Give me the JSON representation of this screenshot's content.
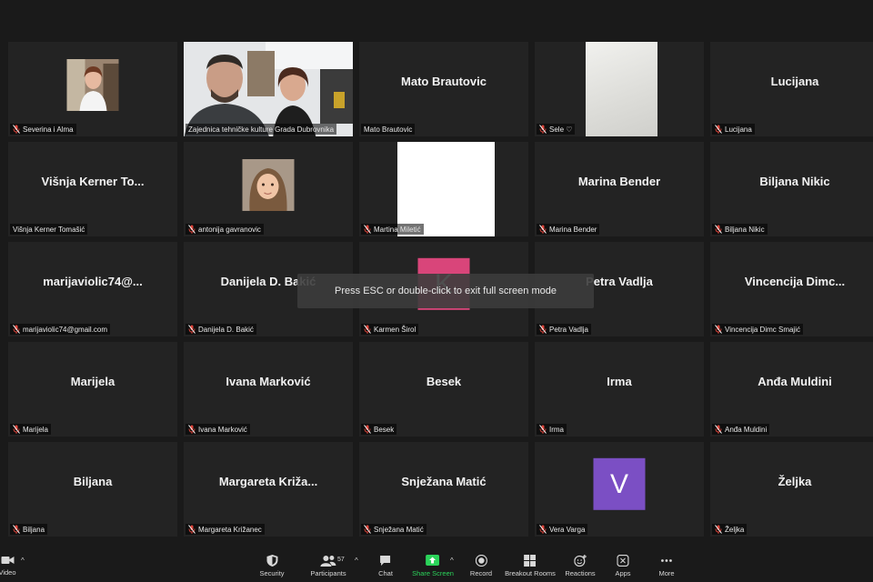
{
  "participants": [
    {
      "name": "Severina i Alma",
      "display": "",
      "muted": true,
      "kind": "photo-woman"
    },
    {
      "name": "Zajednica tehničke kulture Grada Dubrovnika",
      "display": "",
      "muted": false,
      "kind": "video-people",
      "speaking": true
    },
    {
      "name": "Mato Brautovic",
      "display": "Mato Brautovic",
      "muted": false,
      "kind": "name"
    },
    {
      "name": "Sele ♡",
      "display": "",
      "muted": true,
      "kind": "video-wall"
    },
    {
      "name": "Lucijana",
      "display": "Lucijana",
      "muted": true,
      "kind": "name"
    },
    {
      "name": "Višnja Kerner Tomašić",
      "display": "Višnja Kerner To...",
      "muted": false,
      "kind": "name"
    },
    {
      "name": "antonija gavranovic",
      "display": "",
      "muted": true,
      "kind": "photo-child"
    },
    {
      "name": "Martina Miletić",
      "display": "",
      "muted": true,
      "kind": "white"
    },
    {
      "name": "Marina Bender",
      "display": "Marina Bender",
      "muted": true,
      "kind": "name"
    },
    {
      "name": "Biljana Nikic",
      "display": "Biljana Nikic",
      "muted": true,
      "kind": "name"
    },
    {
      "name": "marijaviolic74@gmail.com",
      "display": "marijaviolic74@...",
      "muted": true,
      "kind": "name"
    },
    {
      "name": "Danijela D. Bakić",
      "display": "Danijela D. Bakić",
      "muted": true,
      "kind": "name"
    },
    {
      "name": "Karmen Širol",
      "display": "K",
      "muted": true,
      "kind": "letter",
      "color": "#d9457a"
    },
    {
      "name": "Petra Vadlja",
      "display": "Petra Vadlja",
      "muted": true,
      "kind": "name"
    },
    {
      "name": "Vincencija Dimc Smajić",
      "display": "Vincencija  Dimc...",
      "muted": true,
      "kind": "name"
    },
    {
      "name": "Marijela",
      "display": "Marijela",
      "muted": true,
      "kind": "name"
    },
    {
      "name": "Ivana Marković",
      "display": "Ivana Marković",
      "muted": true,
      "kind": "name"
    },
    {
      "name": "Besek",
      "display": "Besek",
      "muted": true,
      "kind": "name"
    },
    {
      "name": "Irma",
      "display": "Irma",
      "muted": true,
      "kind": "name"
    },
    {
      "name": "Anđa Muldini",
      "display": "Anđa Muldini",
      "muted": true,
      "kind": "name"
    },
    {
      "name": "Biljana",
      "display": "Biljana",
      "muted": true,
      "kind": "name"
    },
    {
      "name": "Margareta Križanec",
      "display": "Margareta Križa...",
      "muted": true,
      "kind": "name"
    },
    {
      "name": "Snježana Matić",
      "display": "Snježana Matić",
      "muted": true,
      "kind": "name"
    },
    {
      "name": "Vera Varga",
      "display": "V",
      "muted": true,
      "kind": "letter",
      "color": "#7b4fc4"
    },
    {
      "name": "Željka",
      "display": "Željka",
      "muted": true,
      "kind": "name"
    }
  ],
  "overlay_text": "Press ESC or double-click to exit full screen mode",
  "toolbar": {
    "video_label": "Video",
    "security": "Security",
    "participants": "Participants",
    "participants_count": "57",
    "chat": "Chat",
    "share_screen": "Share Screen",
    "record": "Record",
    "breakout": "Breakout Rooms",
    "reactions": "Reactions",
    "apps": "Apps",
    "more": "More"
  },
  "colors": {
    "share_accent": "#2bd45a",
    "muted_red": "#e0443a",
    "speaking_border": "#c8e05a"
  }
}
